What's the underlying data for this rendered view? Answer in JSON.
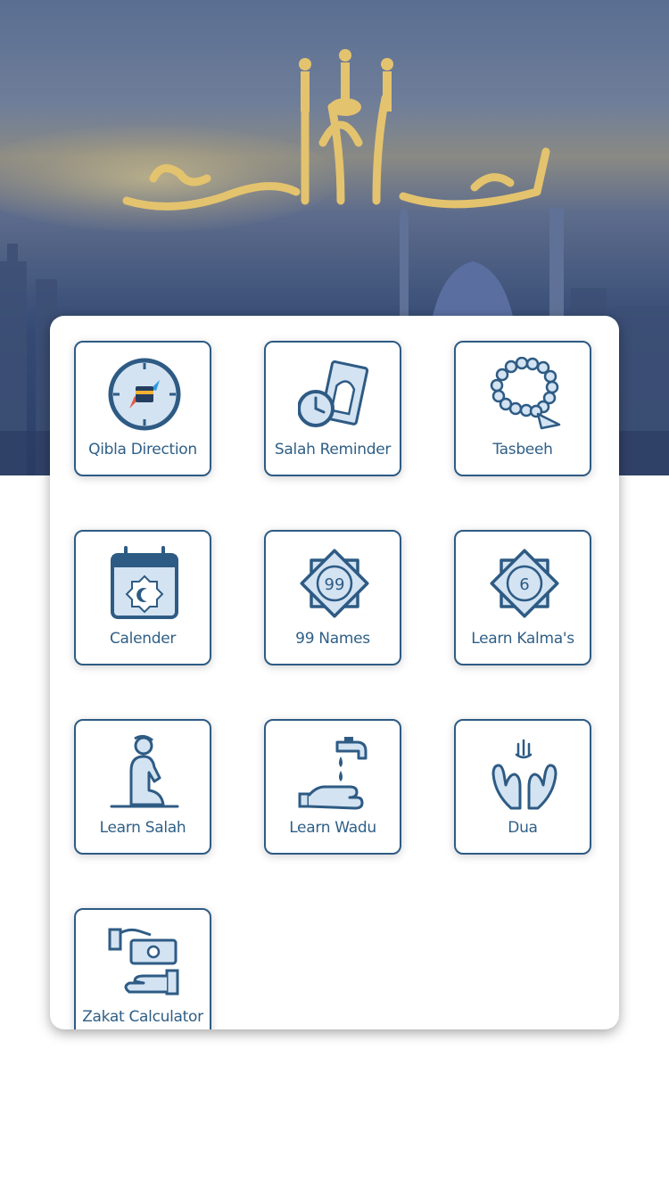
{
  "header": {
    "calligraphy_text": "بسم الله الرحمن الرحيم",
    "colors": {
      "sky_top": "#5a6e92",
      "sky_bottom": "#2b3f68",
      "gold": "#e4c36e"
    }
  },
  "menu": {
    "items": [
      {
        "label": "Qibla Direction",
        "icon": "compass-icon"
      },
      {
        "label": "Salah Reminder",
        "icon": "prayer-mat-clock-icon"
      },
      {
        "label": "Tasbeeh",
        "icon": "prayer-beads-icon"
      },
      {
        "label": "Calender",
        "icon": "calendar-icon"
      },
      {
        "label": "99 Names",
        "icon": "star-99-icon",
        "badge": "99"
      },
      {
        "label": "Learn Kalma's",
        "icon": "star-6-icon",
        "badge": "6"
      },
      {
        "label": "Learn Salah",
        "icon": "praying-man-icon"
      },
      {
        "label": "Learn Wadu",
        "icon": "tap-hand-icon"
      },
      {
        "label": "Dua",
        "icon": "raised-hands-icon"
      },
      {
        "label": "Zakat Calculator",
        "icon": "money-hand-icon"
      }
    ],
    "colors": {
      "accent": "#2e5b84",
      "icon_fill": "#d3e3f2",
      "text": "#2f5f86"
    }
  }
}
